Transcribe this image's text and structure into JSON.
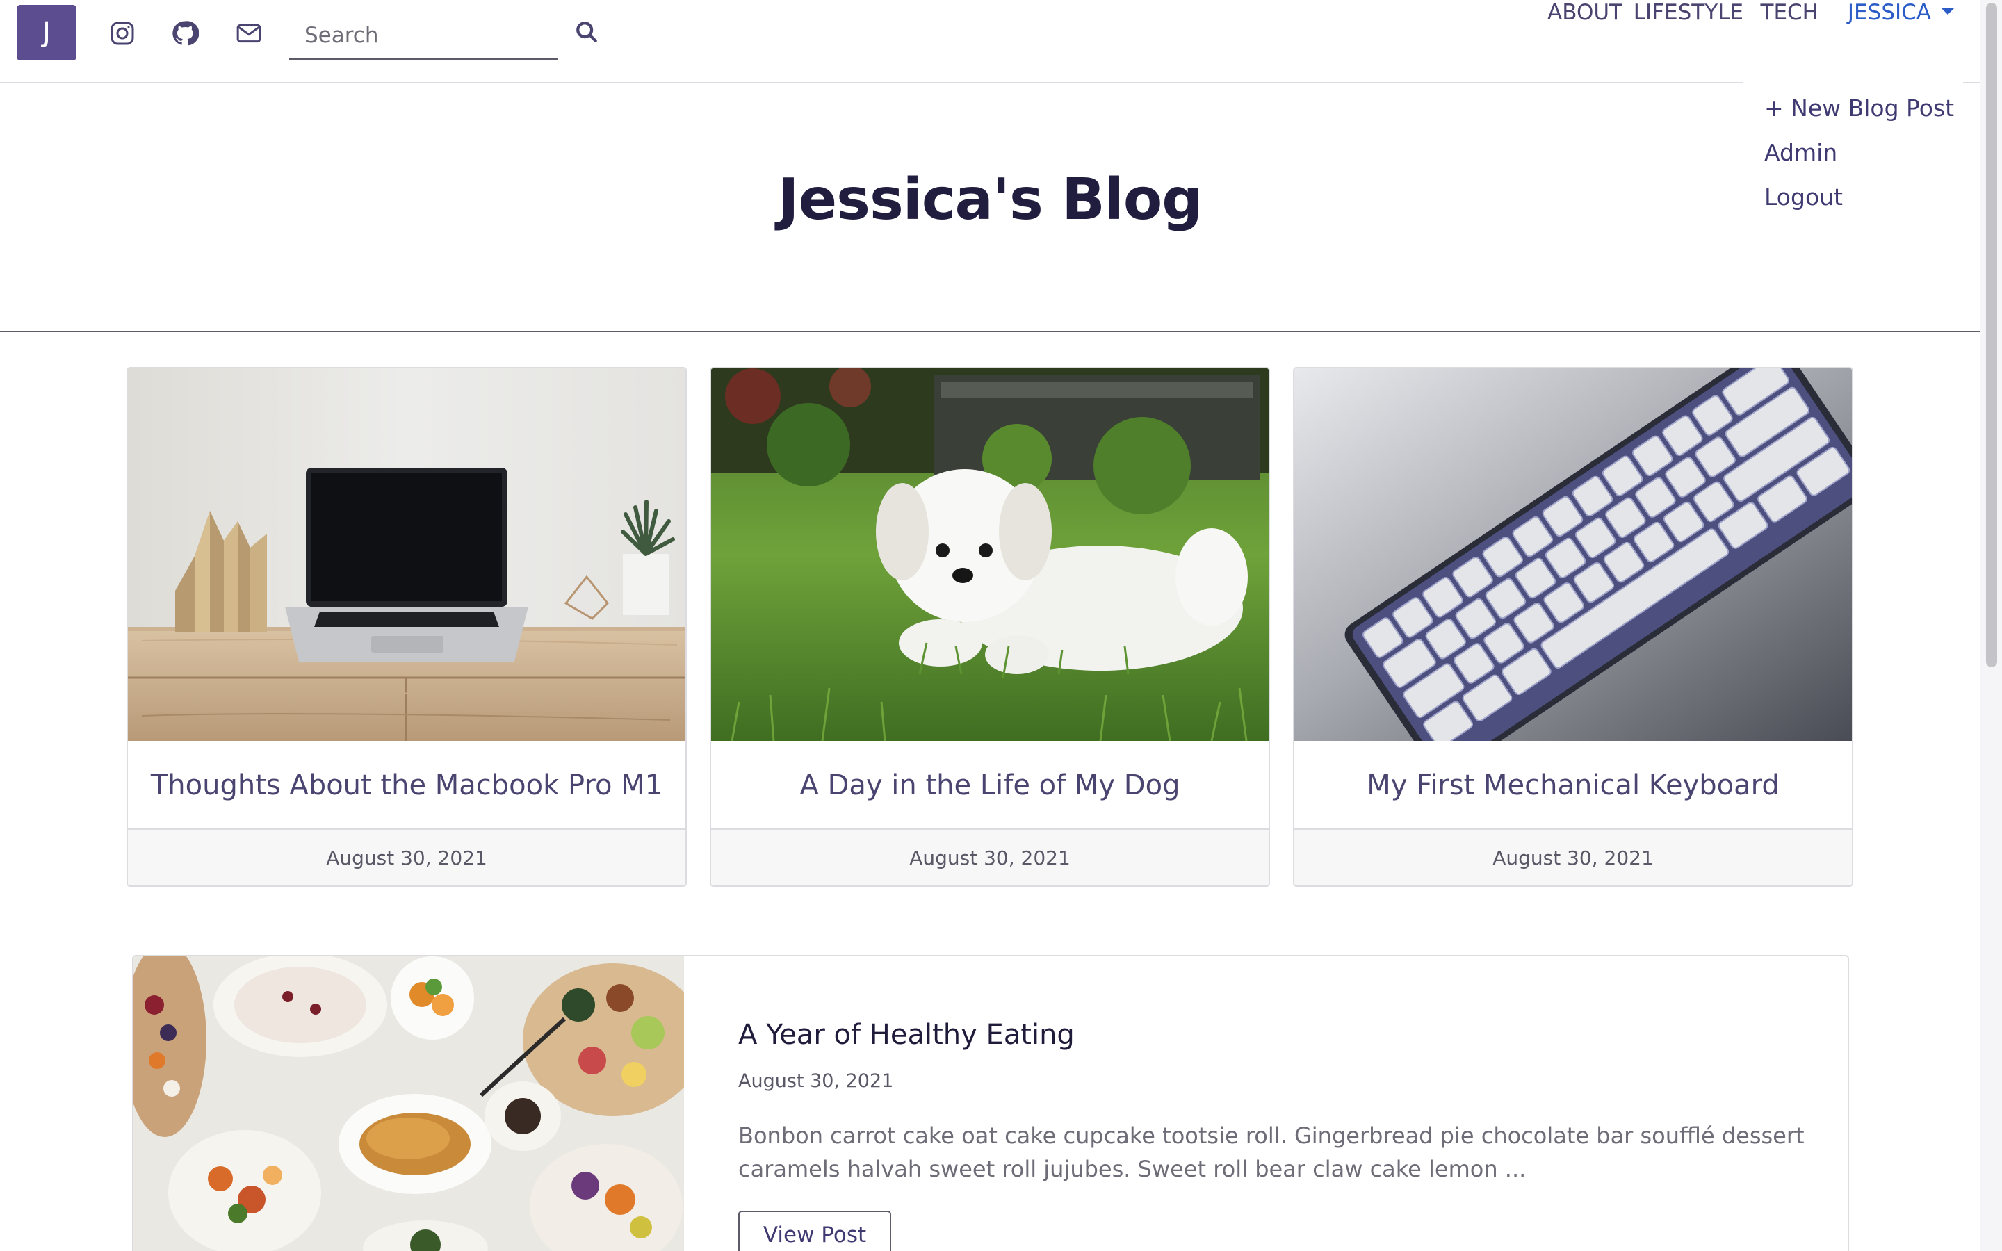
{
  "brand": {
    "letter": "J",
    "color": "#5b4d8f"
  },
  "social": [
    {
      "name": "instagram-icon"
    },
    {
      "name": "github-icon"
    },
    {
      "name": "envelope-icon"
    }
  ],
  "search": {
    "placeholder": "Search",
    "value": "",
    "icon": "magnifier-icon"
  },
  "nav": {
    "links": [
      {
        "label": "ABOUT"
      },
      {
        "label": "LIFESTYLE"
      },
      {
        "label": "TECH"
      },
      {
        "label": "JESSICA",
        "active": true,
        "dropdown": true
      }
    ]
  },
  "dropdown": {
    "items": [
      {
        "label": "+ New Blog Post"
      },
      {
        "label": "Admin"
      },
      {
        "label": "Logout"
      }
    ]
  },
  "page": {
    "title": "Jessica's Blog"
  },
  "cards": [
    {
      "title": "Thoughts About the Macbook Pro M1",
      "date": "August 30, 2021",
      "image": "laptop-on-desk"
    },
    {
      "title": "A Day in the Life of My Dog",
      "date": "August 30, 2021",
      "image": "white-dog-on-grass"
    },
    {
      "title": "My First Mechanical Keyboard",
      "date": "August 30, 2021",
      "image": "mechanical-keyboard"
    }
  ],
  "featured": {
    "title": "A Year of Healthy Eating",
    "date": "August 30, 2021",
    "excerpt": "Bonbon carrot cake oat cake cupcake tootsie roll. Gingerbread pie chocolate bar soufflé dessert caramels halvah sweet roll jujubes. Sweet roll bear claw cake lemon ...",
    "button_label": "View Post",
    "image": "food-platters"
  },
  "colors": {
    "accent": "#5b4d8f",
    "nav_text": "#4a4470",
    "active_link": "#2b5cc7",
    "title": "#211d3f"
  }
}
